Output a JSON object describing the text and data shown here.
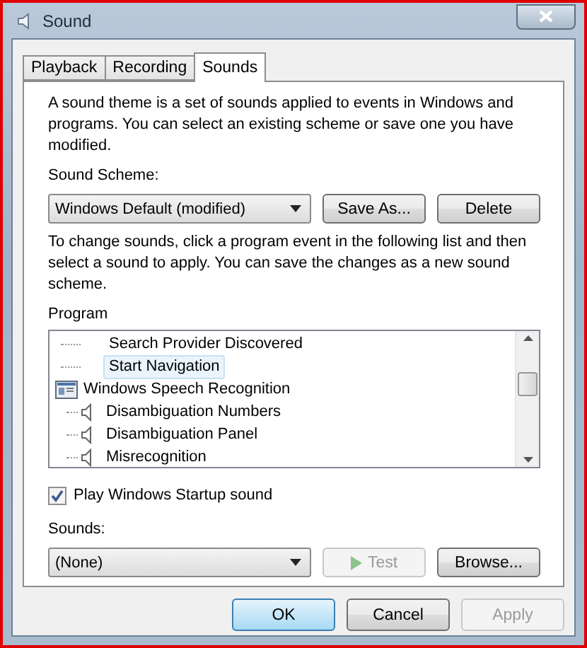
{
  "window": {
    "title": "Sound"
  },
  "tabs": [
    {
      "label": "Playback",
      "selected": false
    },
    {
      "label": "Recording",
      "selected": false
    },
    {
      "label": "Sounds",
      "selected": true
    }
  ],
  "intro": "A sound theme is a set of sounds applied to events in Windows and programs.  You can select an existing scheme or save one you have modified.",
  "scheme": {
    "label": "Sound Scheme:",
    "value": "Windows Default (modified)",
    "buttons": [
      {
        "label": "Save As...",
        "disabled": false
      },
      {
        "label": "Delete",
        "disabled": false
      }
    ]
  },
  "instructions": "To change sounds, click a program event in the following list and then select a sound to apply.  You can save the changes as a new sound scheme.",
  "program": {
    "label": "Program",
    "items": [
      {
        "kind": "event",
        "label": "Search Provider Discovered",
        "has_sound": false,
        "selected": false
      },
      {
        "kind": "event",
        "label": "Start Navigation",
        "has_sound": false,
        "selected": true
      },
      {
        "kind": "app",
        "label": "Windows Speech Recognition",
        "selected": false,
        "children": [
          {
            "kind": "event",
            "label": "Disambiguation Numbers",
            "has_sound": true,
            "selected": false
          },
          {
            "kind": "event",
            "label": "Disambiguation Panel",
            "has_sound": true,
            "selected": false
          },
          {
            "kind": "event",
            "label": "Misrecognition",
            "has_sound": true,
            "selected": false
          }
        ]
      }
    ]
  },
  "startup": {
    "label": "Play Windows Startup sound",
    "checked": true
  },
  "sounds": {
    "label": "Sounds:",
    "value": "(None)",
    "buttons": [
      {
        "kind": "test",
        "label": "Test",
        "disabled": true
      },
      {
        "kind": "browse",
        "label": "Browse...",
        "disabled": false
      }
    ]
  },
  "footer_buttons": [
    {
      "label": "OK",
      "default": true,
      "disabled": false
    },
    {
      "label": "Cancel",
      "default": false,
      "disabled": false
    },
    {
      "label": "Apply",
      "default": false,
      "disabled": true
    }
  ]
}
